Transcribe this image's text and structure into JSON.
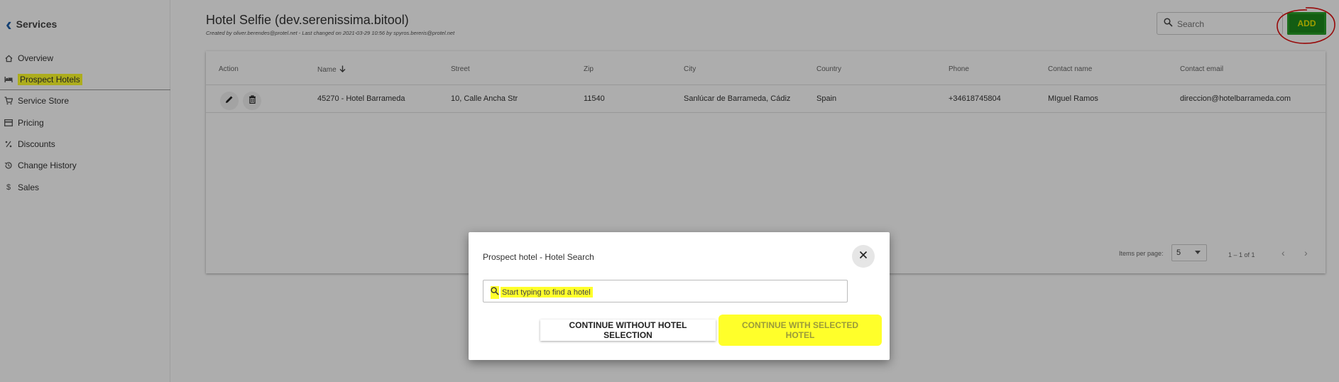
{
  "sidebar": {
    "back_label": "Services",
    "items": [
      {
        "label": "Overview",
        "icon": "home-icon"
      },
      {
        "label": "Prospect Hotels",
        "icon": "bed-icon",
        "active": true
      },
      {
        "label": "Service Store",
        "icon": "cart-icon"
      },
      {
        "label": "Pricing",
        "icon": "card-icon"
      },
      {
        "label": "Discounts",
        "icon": "discount-icon"
      },
      {
        "label": "Change History",
        "icon": "history-icon"
      },
      {
        "label": "Sales",
        "icon": "dollar-icon"
      }
    ]
  },
  "header": {
    "title": "Hotel Selfie (dev.serenissima.bitool)",
    "subtitle": "Created by oliver.berendes@protel.net - Last changed on 2021-03-29 10:56 by spyros.bereris@protel.net",
    "search_placeholder": "Search",
    "add_label": "ADD"
  },
  "table": {
    "columns": [
      "Action",
      "Name",
      "Street",
      "Zip",
      "City",
      "Country",
      "Phone",
      "Contact name",
      "Contact email"
    ],
    "rows": [
      {
        "name": "45270 - Hotel Barrameda",
        "street": "10, Calle Ancha Str",
        "zip": "11540",
        "city": "Sanlúcar de Barrameda, Cádiz",
        "country": "Spain",
        "phone": "+34618745804",
        "contact_name": "MIguel Ramos",
        "contact_email": "direccion@hotelbarrameda.com"
      }
    ],
    "items_per_page_label": "Items per page:",
    "items_per_page": "5",
    "range_label": "1 – 1 of 1"
  },
  "dialog": {
    "title": "Prospect hotel - Hotel Search",
    "search_placeholder": "Start typing to find a hotel",
    "btn_without": "CONTINUE WITHOUT HOTEL SELECTION",
    "btn_with": "CONTINUE WITH SELECTED HOTEL"
  },
  "colors": {
    "accent_blue": "#1f5fa8",
    "add_green": "#1c8a1c",
    "highlight_yellow": "#ffff2a",
    "annotation_red": "#e01010"
  }
}
